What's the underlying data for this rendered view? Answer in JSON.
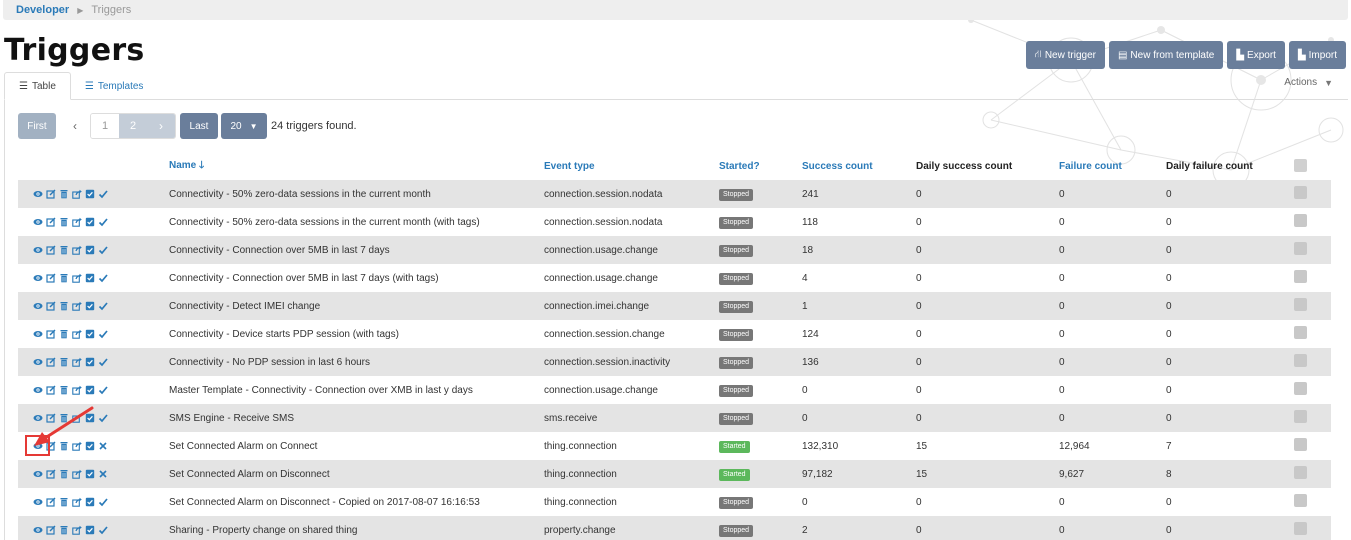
{
  "breadcrumb": {
    "parent": "Developer",
    "current": "Triggers"
  },
  "page_title": "Triggers",
  "top_buttons": {
    "new_trigger": "New trigger",
    "new_from_template": "New from template",
    "export": "Export",
    "import": "Import"
  },
  "tabs": [
    {
      "label": "Table",
      "active": true
    },
    {
      "label": "Templates",
      "active": false
    }
  ],
  "actions_label": "Actions",
  "pagination": {
    "first": "First",
    "pages": [
      "1",
      "2"
    ],
    "last": "Last",
    "page_size": "20",
    "found_text": "24 triggers found."
  },
  "columns": {
    "name": "Name",
    "event_type": "Event type",
    "started": "Started?",
    "success_count": "Success count",
    "daily_success_count": "Daily success count",
    "failure_count": "Failure count",
    "daily_failure_count": "Daily failure count"
  },
  "colors": {
    "link": "#2a7ab8",
    "button": "#6a7e9b",
    "stopped": "#777777",
    "started": "#5cb85c",
    "highlight": "#e53935"
  },
  "rows": [
    {
      "name": "Connectivity - 50% zero-data sessions in the current month",
      "event_type": "connection.session.nodata",
      "status": "Stopped",
      "success": "241",
      "daily_success": "0",
      "failure": "0",
      "daily_failure": "0"
    },
    {
      "name": "Connectivity - 50% zero-data sessions in the current month (with tags)",
      "event_type": "connection.session.nodata",
      "status": "Stopped",
      "success": "118",
      "daily_success": "0",
      "failure": "0",
      "daily_failure": "0"
    },
    {
      "name": "Connectivity - Connection over 5MB in last 7 days",
      "event_type": "connection.usage.change",
      "status": "Stopped",
      "success": "18",
      "daily_success": "0",
      "failure": "0",
      "daily_failure": "0"
    },
    {
      "name": "Connectivity - Connection over 5MB in last 7 days (with tags)",
      "event_type": "connection.usage.change",
      "status": "Stopped",
      "success": "4",
      "daily_success": "0",
      "failure": "0",
      "daily_failure": "0"
    },
    {
      "name": "Connectivity - Detect IMEI change",
      "event_type": "connection.imei.change",
      "status": "Stopped",
      "success": "1",
      "daily_success": "0",
      "failure": "0",
      "daily_failure": "0"
    },
    {
      "name": "Connectivity - Device starts PDP session (with tags)",
      "event_type": "connection.session.change",
      "status": "Stopped",
      "success": "124",
      "daily_success": "0",
      "failure": "0",
      "daily_failure": "0"
    },
    {
      "name": "Connectivity - No PDP session in last 6 hours",
      "event_type": "connection.session.inactivity",
      "status": "Stopped",
      "success": "136",
      "daily_success": "0",
      "failure": "0",
      "daily_failure": "0"
    },
    {
      "name": "Master Template - Connectivity - Connection over XMB in last y days",
      "event_type": "connection.usage.change",
      "status": "Stopped",
      "success": "0",
      "daily_success": "0",
      "failure": "0",
      "daily_failure": "0"
    },
    {
      "name": "SMS Engine - Receive SMS",
      "event_type": "sms.receive",
      "status": "Stopped",
      "success": "0",
      "daily_success": "0",
      "failure": "0",
      "daily_failure": "0"
    },
    {
      "name": "Set Connected Alarm on Connect",
      "event_type": "thing.connection",
      "status": "Started",
      "success": "132,310",
      "daily_success": "15",
      "failure": "12,964",
      "daily_failure": "7"
    },
    {
      "name": "Set Connected Alarm on Disconnect",
      "event_type": "thing.connection",
      "status": "Started",
      "success": "97,182",
      "daily_success": "15",
      "failure": "9,627",
      "daily_failure": "8"
    },
    {
      "name": "Set Connected Alarm on Disconnect - Copied on 2017-08-07 16:16:53",
      "event_type": "thing.connection",
      "status": "Stopped",
      "success": "0",
      "daily_success": "0",
      "failure": "0",
      "daily_failure": "0"
    },
    {
      "name": "Sharing - Property change on shared thing",
      "event_type": "property.change",
      "status": "Stopped",
      "success": "2",
      "daily_success": "0",
      "failure": "0",
      "daily_failure": "0"
    }
  ]
}
